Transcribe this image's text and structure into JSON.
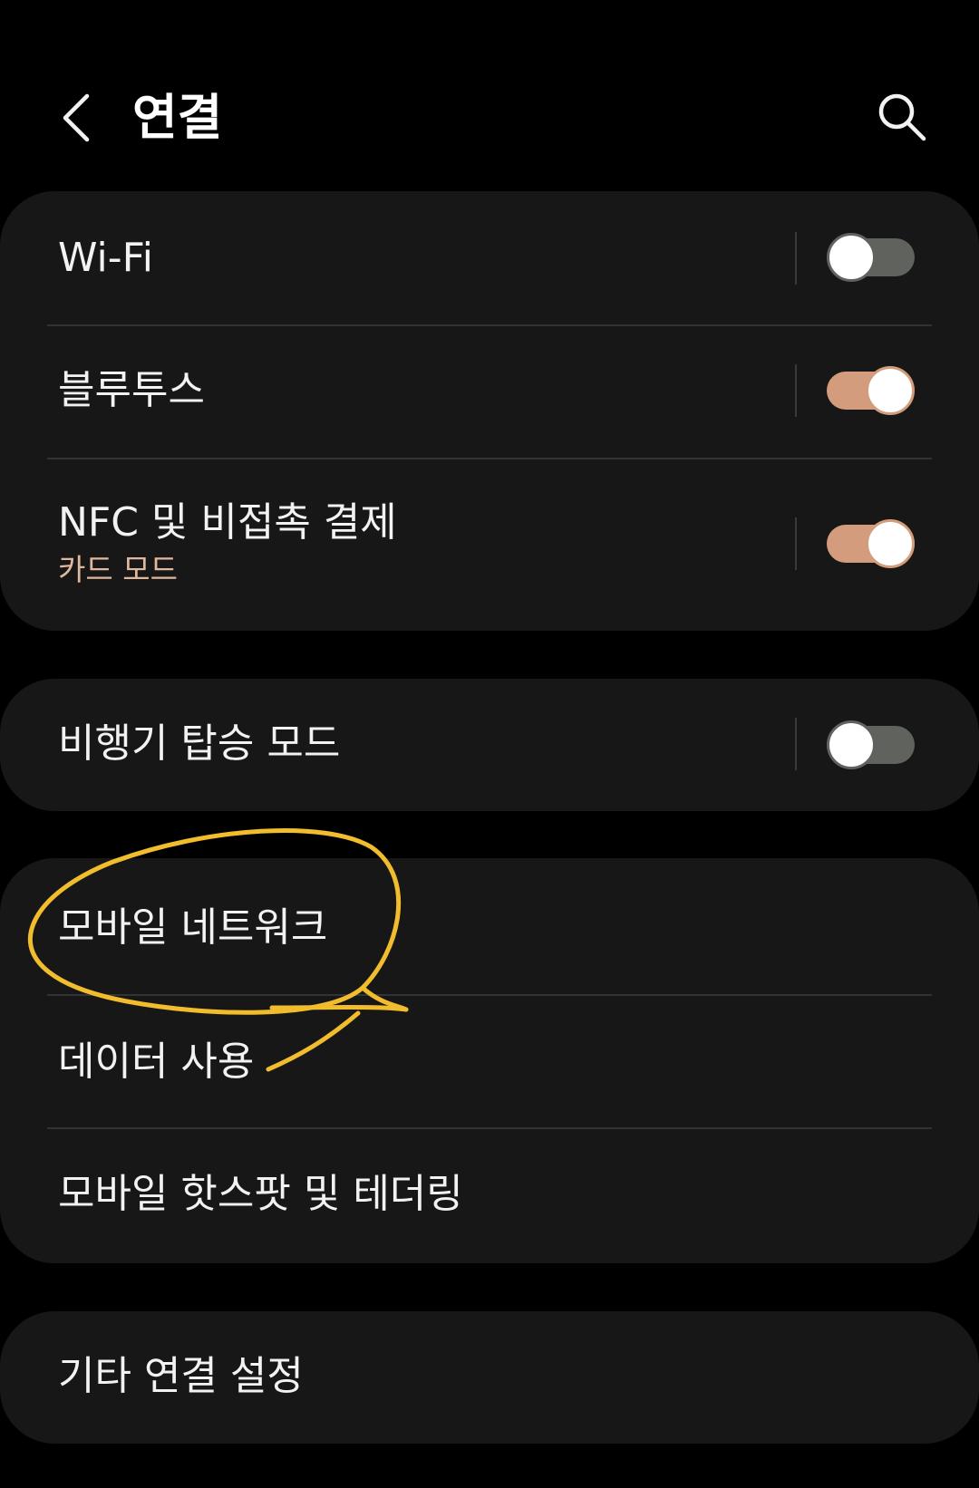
{
  "header": {
    "title": "연결",
    "back_icon": "back-arrow-icon",
    "search_icon": "search-icon"
  },
  "connections": {
    "wifi": {
      "label": "Wi-Fi",
      "enabled": false
    },
    "bluetooth": {
      "label": "블루투스",
      "enabled": true
    },
    "nfc": {
      "label": "NFC 및 비접촉 결제",
      "sublabel": "카드 모드",
      "enabled": true
    }
  },
  "airplane": {
    "label": "비행기 탑승 모드",
    "enabled": false
  },
  "mobile": {
    "items": [
      {
        "label": "모바일 네트워크"
      },
      {
        "label": "데이터 사용"
      },
      {
        "label": "모바일 핫스팟 및 테더링"
      }
    ]
  },
  "other": {
    "label": "기타 연결 설정"
  },
  "colors": {
    "background": "#000000",
    "card": "#171717",
    "toggle_on": "#d39c7d",
    "toggle_off": "#5f625d",
    "accent_text": "#e0b89d",
    "annotation": "#f2bd2c"
  }
}
